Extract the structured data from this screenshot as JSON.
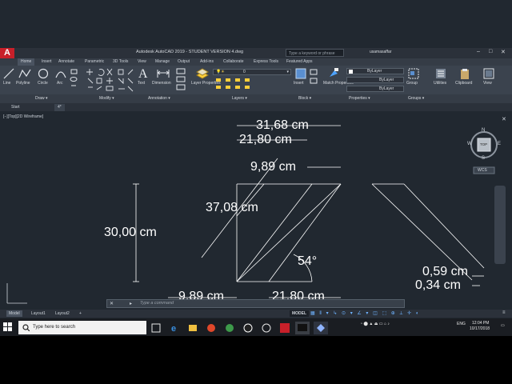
{
  "app": {
    "logo": "A",
    "title": "Autodesk AutoCAD 2019 - STUDENT VERSION   4.dwg",
    "search_placeholder": "Type a keyword or phrase",
    "user": "usamasaffar"
  },
  "ribbon_tabs": [
    "Home",
    "Insert",
    "Annotate",
    "Parametric",
    "3D Tools",
    "View",
    "Manage",
    "Output",
    "Add-ins",
    "Collaborate",
    "Express Tools",
    "Featured Apps"
  ],
  "ribbon": {
    "draw_tools": [
      "Line",
      "Polyline",
      "Circle",
      "Arc"
    ],
    "text_tool": "Text",
    "dimension_tool": "Dimension",
    "layer_properties": "Layer Properties",
    "layer_value": "0",
    "insert": "Insert",
    "match_properties": "Match Properties",
    "bylayer_1": "ByLayer",
    "bylayer_2": "ByLayer",
    "bylayer_3": "ByLayer",
    "group": "Group",
    "utilities": "Utilities",
    "clipboard": "Clipboard",
    "view": "View",
    "panels": [
      "Draw ▾",
      "Modify ▾",
      "Annotation ▾",
      "Layers ▾",
      "Block ▾",
      "Properties ▾",
      "Groups ▾"
    ]
  },
  "doc_tabs": [
    "Start",
    "4*"
  ],
  "viewport_label": "[−][Top][2D Wireframe]",
  "viewcube": {
    "north": "N",
    "south": "S",
    "west": "W",
    "east": "E",
    "face": "TOP",
    "wcs": "WCS"
  },
  "dimensions": {
    "top_total": "31,68 cm",
    "top_left": "21,80 cm",
    "top_gap": "9,89 cm",
    "diagonal": "37,08 cm",
    "height": "30,00 cm",
    "angle": "54°",
    "right_a": "0,59 cm",
    "right_b": "0,34 cm",
    "bottom_left": "9,89 cm",
    "bottom_right": "21,80 cm"
  },
  "command_placeholder": "Type a command",
  "layout_tabs": [
    "Model",
    "Layout1",
    "Layout2"
  ],
  "status": {
    "model": "MODEL"
  },
  "taskbar": {
    "search": "Type here to search",
    "lang": "ENG",
    "time": "12:04 PM",
    "date": "10/17/2018"
  },
  "colors": {
    "canvas": "#212830",
    "ribbon": "#3b434e",
    "logo": "#c8202a",
    "dim_text": "#ffffff"
  }
}
